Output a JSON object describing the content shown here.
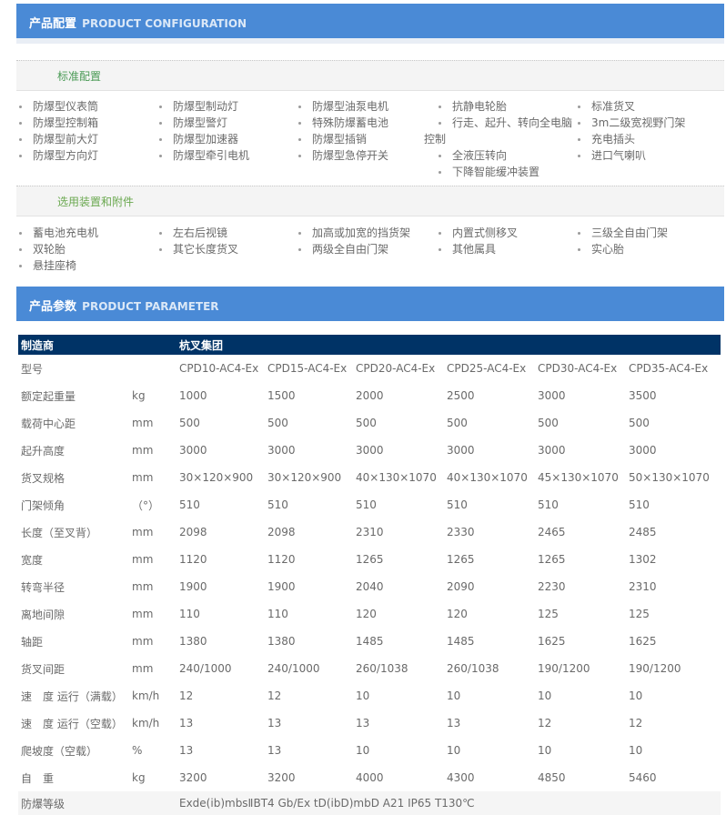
{
  "config_header": {
    "cn": "产品配置",
    "en": "PRODUCT CONFIGURATION"
  },
  "standard": {
    "title": "标准配置",
    "columns": [
      {
        "items": [
          "防爆型仪表筒",
          "防爆型控制箱",
          "防爆型前大灯",
          "防爆型方向灯"
        ]
      },
      {
        "items": [
          "防爆型制动灯",
          "防爆型警灯",
          "防爆型加速器",
          "防爆型牵引电机"
        ]
      },
      {
        "items": [
          "防爆型油泵电机",
          "特殊防爆蓄电池",
          "防爆型插销",
          "防爆型急停开关"
        ]
      },
      {
        "items": [
          "抗静电轮胎",
          "行走、起升、转向全电脑",
          "全液压转向",
          "下降智能缓冲装置"
        ],
        "continuation": "控制"
      },
      {
        "items": [
          "标准货叉",
          "3m二级宽视野门架",
          "充电插头",
          "进口气喇叭"
        ]
      }
    ]
  },
  "optional": {
    "title": "选用装置和附件",
    "columns": [
      {
        "items": [
          "蓄电池充电机",
          "双轮胎",
          "悬挂座椅"
        ]
      },
      {
        "items": [
          "左右后视镜",
          "其它长度货叉"
        ]
      },
      {
        "items": [
          "加高或加宽的挡货架",
          "两级全自由门架"
        ]
      },
      {
        "items": [
          "内置式侧移叉",
          "其他属具"
        ]
      },
      {
        "items": [
          "三级全自由门架",
          "实心胎"
        ]
      }
    ]
  },
  "param_header": {
    "cn": "产品参数",
    "en": "PRODUCT PARAMETER"
  },
  "params": {
    "manufacturer_label": "制造商",
    "manufacturer_value": "杭叉集团",
    "rows": [
      {
        "label": "型号",
        "unit": "",
        "values": [
          "CPD10-AC4-Ex",
          "CPD15-AC4-Ex",
          "CPD20-AC4-Ex",
          "CPD25-AC4-Ex",
          "CPD30-AC4-Ex",
          "CPD35-AC4-Ex"
        ]
      },
      {
        "label": "额定起重量",
        "unit": "kg",
        "values": [
          "1000",
          "1500",
          "2000",
          "2500",
          "3000",
          "3500"
        ]
      },
      {
        "label": "载荷中心距",
        "unit": "mm",
        "values": [
          "500",
          "500",
          "500",
          "500",
          "500",
          "500"
        ]
      },
      {
        "label": "起升高度",
        "unit": "mm",
        "values": [
          "3000",
          "3000",
          "3000",
          "3000",
          "3000",
          "3000"
        ]
      },
      {
        "label": "货叉规格",
        "unit": "mm",
        "values": [
          "30×120×900",
          "30×120×900",
          "40×130×1070",
          "40×130×1070",
          "45×130×1070",
          "50×130×1070"
        ]
      },
      {
        "label": "门架倾角",
        "unit": "（°）",
        "values": [
          "510",
          "510",
          "510",
          "510",
          "510",
          "510"
        ]
      },
      {
        "label": "长度（至叉背）",
        "unit": "mm",
        "values": [
          "2098",
          "2098",
          "2310",
          "2330",
          "2465",
          "2485"
        ]
      },
      {
        "label": "宽度",
        "unit": "mm",
        "values": [
          "1120",
          "1120",
          "1265",
          "1265",
          "1265",
          "1302"
        ]
      },
      {
        "label": "转弯半径",
        "unit": "mm",
        "values": [
          "1900",
          "1900",
          "2040",
          "2090",
          "2230",
          "2310"
        ]
      },
      {
        "label": "离地间隙",
        "unit": "mm",
        "values": [
          "110",
          "110",
          "120",
          "120",
          "125",
          "125"
        ]
      },
      {
        "label": "轴距",
        "unit": "mm",
        "values": [
          "1380",
          "1380",
          "1485",
          "1485",
          "1625",
          "1625"
        ]
      },
      {
        "label": "货叉间距",
        "unit": "mm",
        "values": [
          "240/1000",
          "240/1000",
          "260/1038",
          "260/1038",
          "190/1200",
          "190/1200"
        ]
      },
      {
        "label": "速　度 运行（满载）",
        "unit": "km/h",
        "values": [
          "12",
          "12",
          "10",
          "10",
          "10",
          "10"
        ]
      },
      {
        "label": "速　度 运行（空载）",
        "unit": "km/h",
        "values": [
          "13",
          "13",
          "13",
          "13",
          "12",
          "12"
        ]
      },
      {
        "label": "爬坡度（空载）",
        "unit": "%",
        "values": [
          "13",
          "13",
          "10",
          "10",
          "10",
          "10"
        ]
      },
      {
        "label": "自　重",
        "unit": "kg",
        "values": [
          "3200",
          "3200",
          "4000",
          "4300",
          "4850",
          "5460"
        ]
      }
    ],
    "explosion_label": "防爆等级",
    "explosion_value": "Exde(ib)mbsⅡBT4 Gb/Ex tD(ibD)mbD A21 IP65 T130℃"
  }
}
